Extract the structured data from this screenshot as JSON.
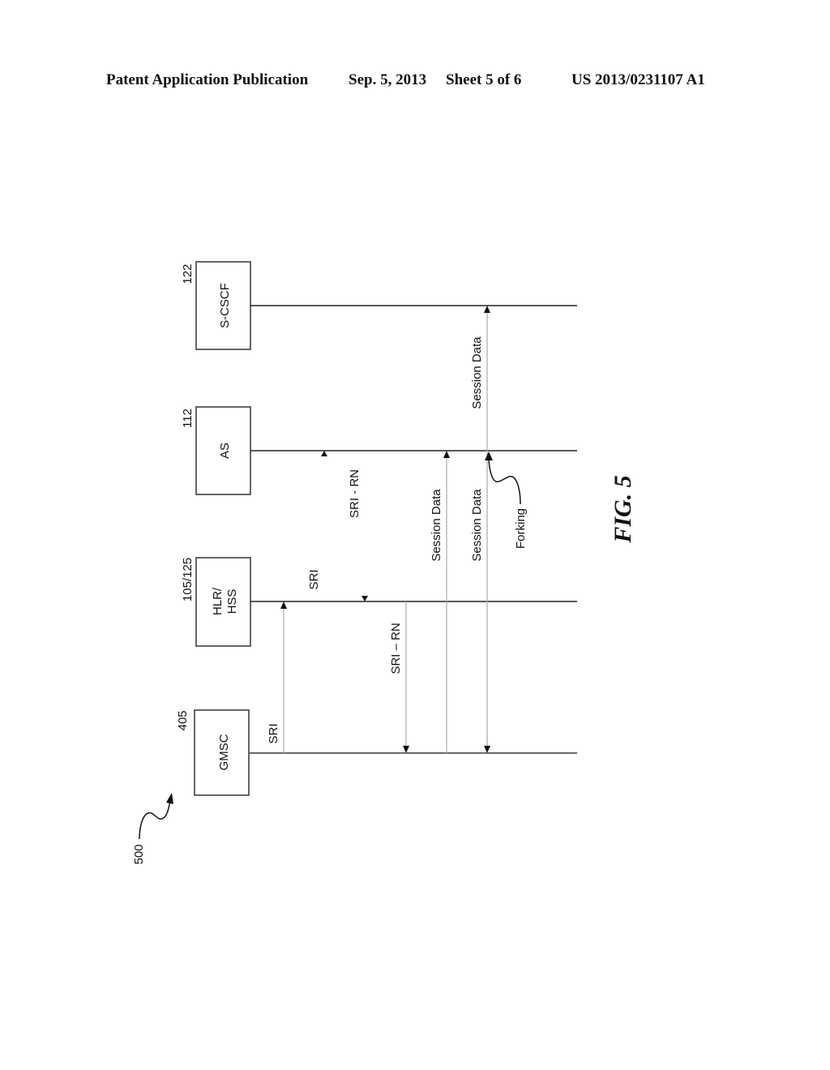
{
  "header": {
    "publication": "Patent Application Publication",
    "date": "Sep. 5, 2013",
    "sheet": "Sheet 5 of 6",
    "number": "US 2013/0231107 A1"
  },
  "figure": {
    "ref_number": "500",
    "caption": "FIG. 5"
  },
  "entities": [
    {
      "id": "scscf",
      "label": "S-CSCF",
      "label_line2": "",
      "ref": "122"
    },
    {
      "id": "as",
      "label": "AS",
      "label_line2": "",
      "ref": "112"
    },
    {
      "id": "hlr",
      "label": "HLR/",
      "label_line2": "HSS",
      "ref": "105/125"
    },
    {
      "id": "gmsc",
      "label": "GMSC",
      "label_line2": "",
      "ref": "405"
    }
  ],
  "messages": [
    {
      "label": "SRI",
      "from": "GMSC",
      "to": "HLR/HSS"
    },
    {
      "label": "SRI",
      "from": "HLR/HSS",
      "to": "AS"
    },
    {
      "label": "SRI - RN",
      "from": "AS",
      "to": "HLR/HSS"
    },
    {
      "label": "SRI – RN",
      "from": "HLR/HSS",
      "to": "GMSC"
    },
    {
      "label": "Session Data",
      "from": "GMSC",
      "to": "AS"
    },
    {
      "label": "Session Data",
      "from": "AS",
      "to": "GMSC"
    },
    {
      "label": "Session Data",
      "from": "AS",
      "to": "S-CSCF"
    }
  ],
  "annotations": {
    "forking": "Forking"
  }
}
